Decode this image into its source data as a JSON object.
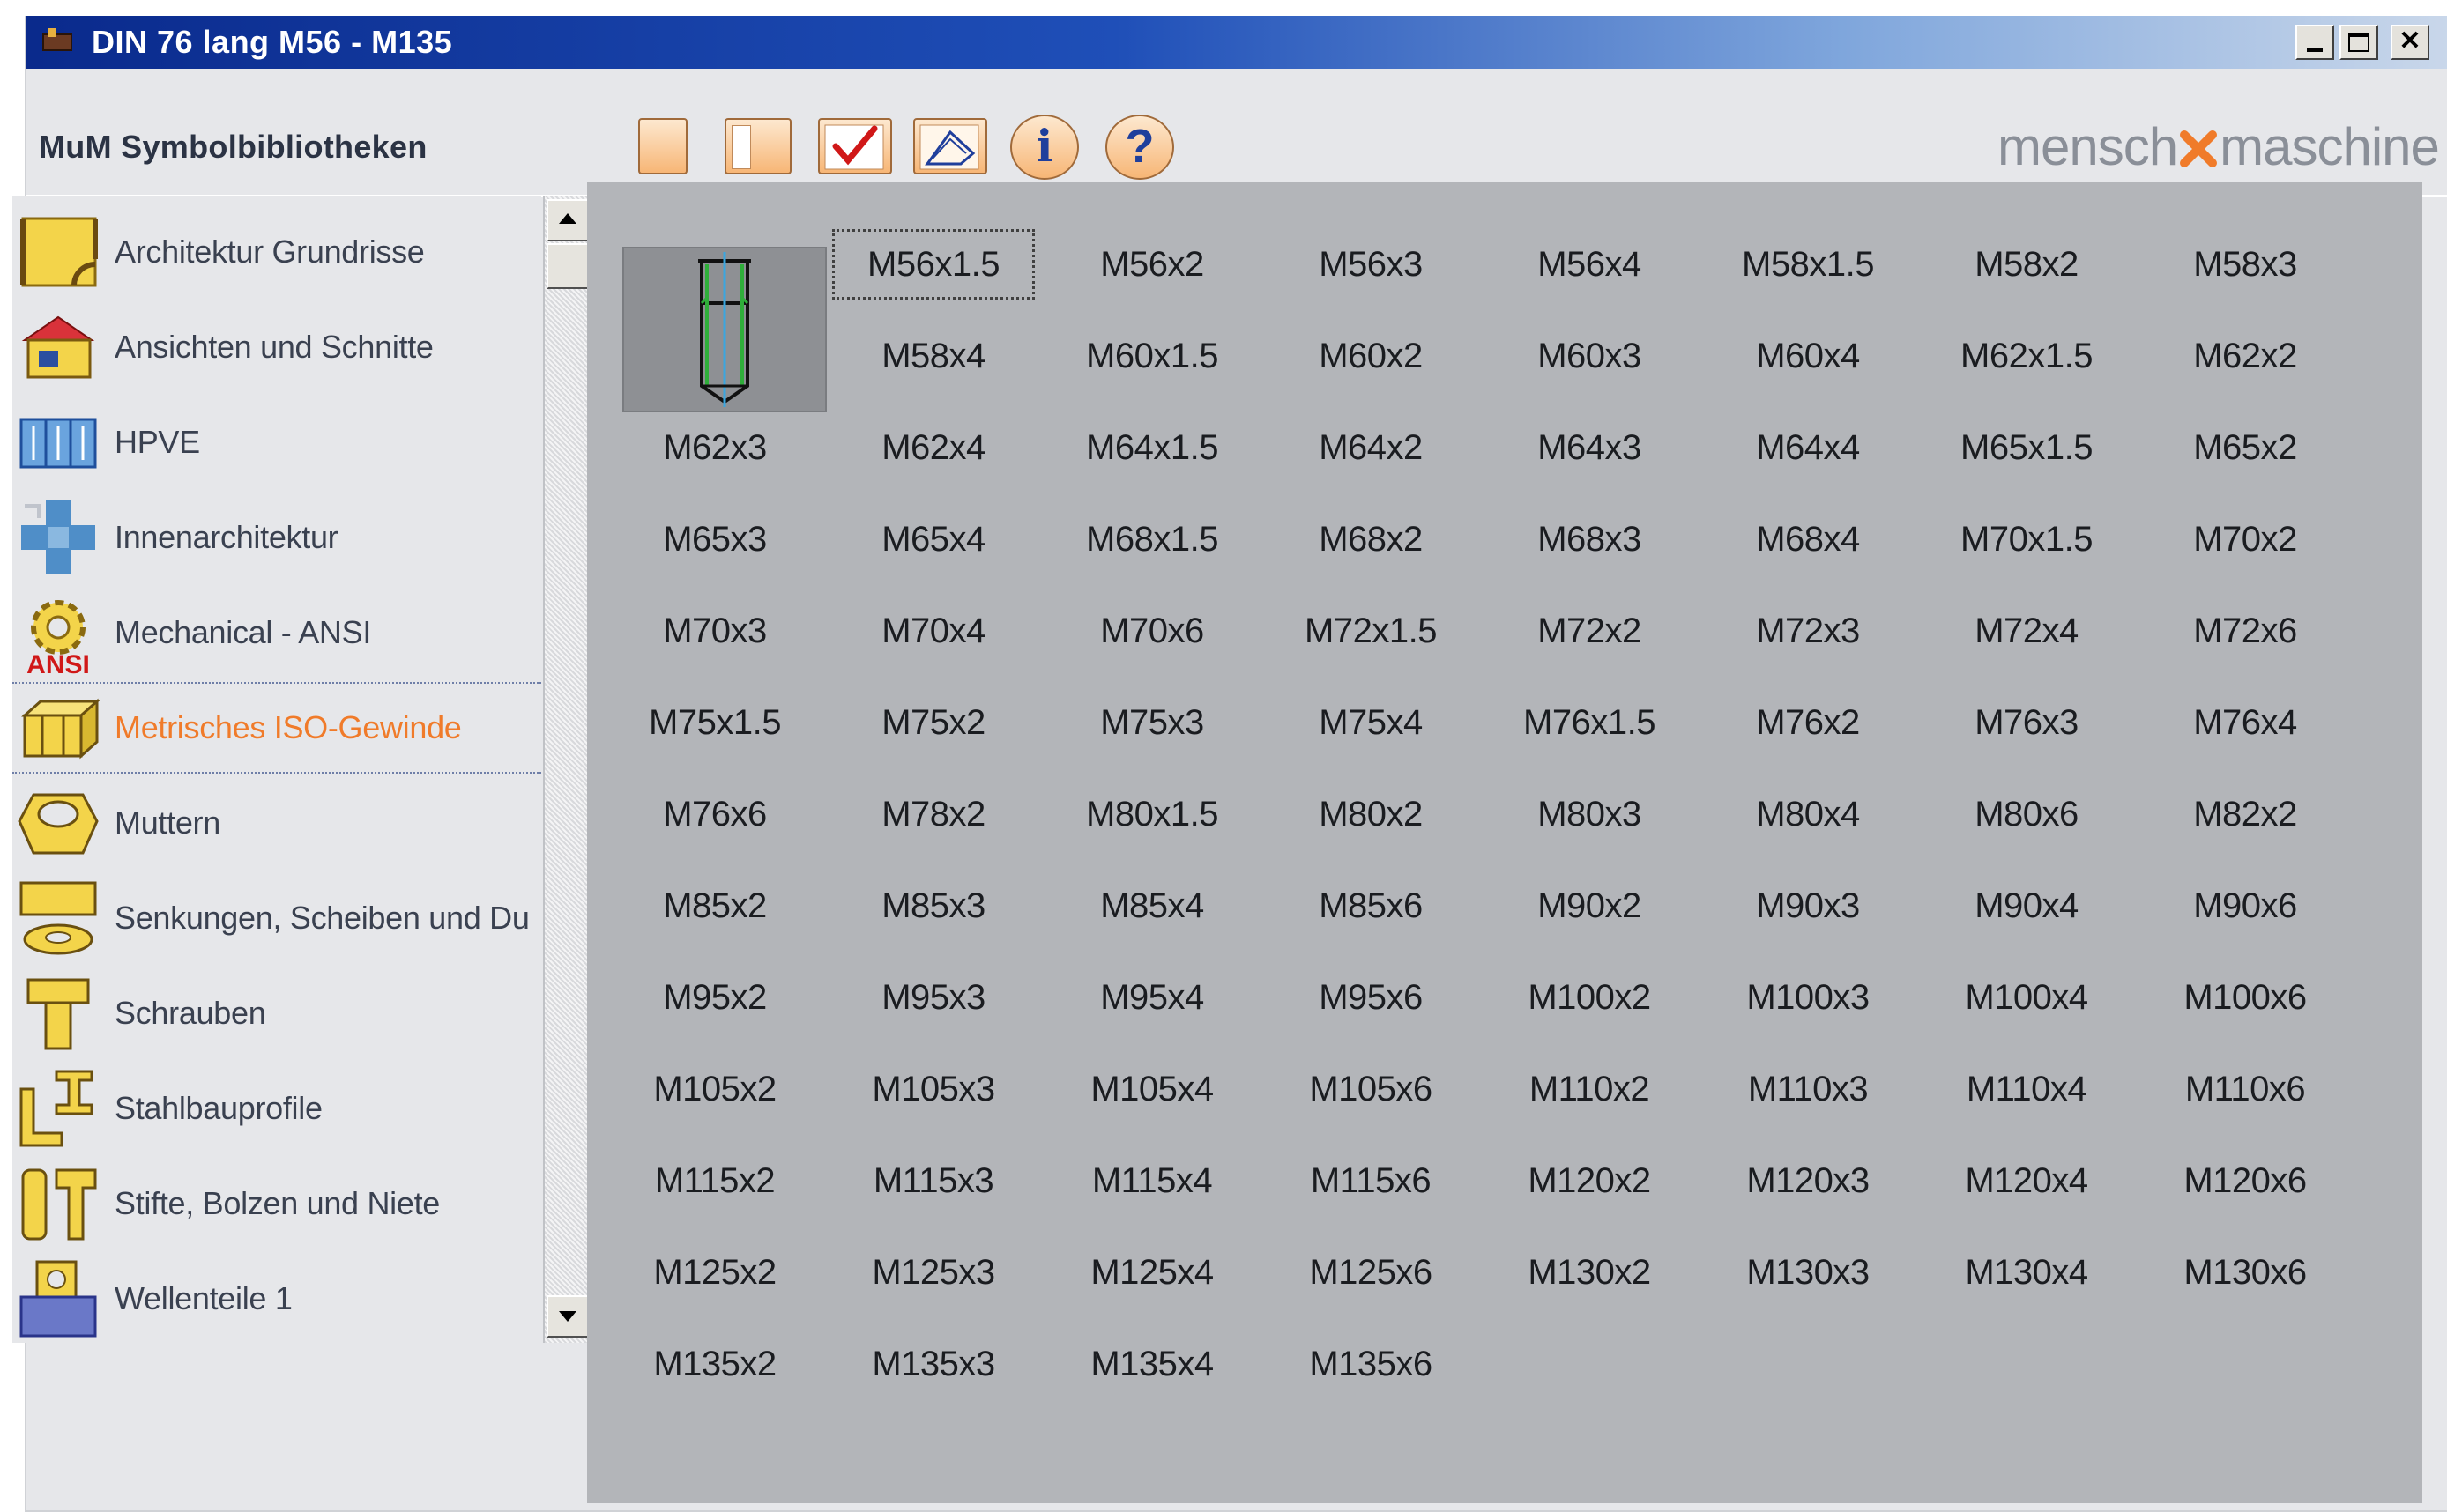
{
  "window": {
    "title": "DIN 76 lang M56 - M135"
  },
  "toolbar": {
    "heading": "MuM Symbolbibliotheken",
    "info_glyph": "i",
    "help_glyph": "?",
    "buttons": [
      "blank-page-icon",
      "page-panel-icon",
      "checkmark-icon",
      "drawing-icon",
      "info-icon",
      "help-icon"
    ],
    "brand_left": "mensch",
    "brand_right": "maschine",
    "brand_color": "#8a8f98",
    "brand_accent": "#f07b2a"
  },
  "sidebar": {
    "items": [
      {
        "label": "Architektur Grundrisse",
        "icon": "floorplan-icon"
      },
      {
        "label": "Ansichten und Schnitte",
        "icon": "house-icon"
      },
      {
        "label": "HPVE",
        "icon": "hpve-icon"
      },
      {
        "label": "Innenarchitektur",
        "icon": "interior-icon"
      },
      {
        "label": "Mechanical - ANSI",
        "icon": "gear-ansi-icon",
        "badge": "ANSI"
      },
      {
        "label": "Metrisches ISO-Gewinde",
        "icon": "thread-block-icon",
        "active": true
      },
      {
        "label": "Muttern",
        "icon": "nut-icon"
      },
      {
        "label": "Senkungen, Scheiben und Du",
        "icon": "washer-icon"
      },
      {
        "label": "Schrauben",
        "icon": "screw-icon"
      },
      {
        "label": "Stahlbauprofile",
        "icon": "steel-profile-icon"
      },
      {
        "label": "Stifte, Bolzen und Niete",
        "icon": "pin-bolt-icon"
      },
      {
        "label": "Wellenteile 1",
        "icon": "shaft-part-icon"
      }
    ],
    "active_color": "#f07b2a"
  },
  "grid": {
    "selected": "M56x1.5",
    "cells": [
      "M56x1.5",
      "M56x2",
      "M56x3",
      "M56x4",
      "M58x1.5",
      "M58x2",
      "M58x3",
      "M58x4",
      "M60x1.5",
      "M60x2",
      "M60x3",
      "M60x4",
      "M62x1.5",
      "M62x2",
      "M62x3",
      "M62x4",
      "M64x1.5",
      "M64x2",
      "M64x3",
      "M64x4",
      "M65x1.5",
      "M65x2",
      "M65x3",
      "M65x4",
      "M68x1.5",
      "M68x2",
      "M68x3",
      "M68x4",
      "M70x1.5",
      "M70x2",
      "M70x3",
      "M70x4",
      "M70x6",
      "M72x1.5",
      "M72x2",
      "M72x3",
      "M72x4",
      "M72x6",
      "M75x1.5",
      "M75x2",
      "M75x3",
      "M75x4",
      "M76x1.5",
      "M76x2",
      "M76x3",
      "M76x4",
      "M76x6",
      "M78x2",
      "M80x1.5",
      "M80x2",
      "M80x3",
      "M80x4",
      "M80x6",
      "M82x2",
      "M85x2",
      "M85x3",
      "M85x4",
      "M85x6",
      "M90x2",
      "M90x3",
      "M90x4",
      "M90x6",
      "M95x2",
      "M95x3",
      "M95x4",
      "M95x6",
      "M100x2",
      "M100x3",
      "M100x4",
      "M100x6",
      "M105x2",
      "M105x3",
      "M105x4",
      "M105x6",
      "M110x2",
      "M110x3",
      "M110x4",
      "M110x6",
      "M115x2",
      "M115x3",
      "M115x4",
      "M115x6",
      "M120x2",
      "M120x3",
      "M120x4",
      "M120x6",
      "M125x2",
      "M125x3",
      "M125x4",
      "M125x6",
      "M130x2",
      "M130x3",
      "M130x4",
      "M130x6",
      "M135x2",
      "M135x3",
      "M135x4",
      "M135x6"
    ]
  }
}
